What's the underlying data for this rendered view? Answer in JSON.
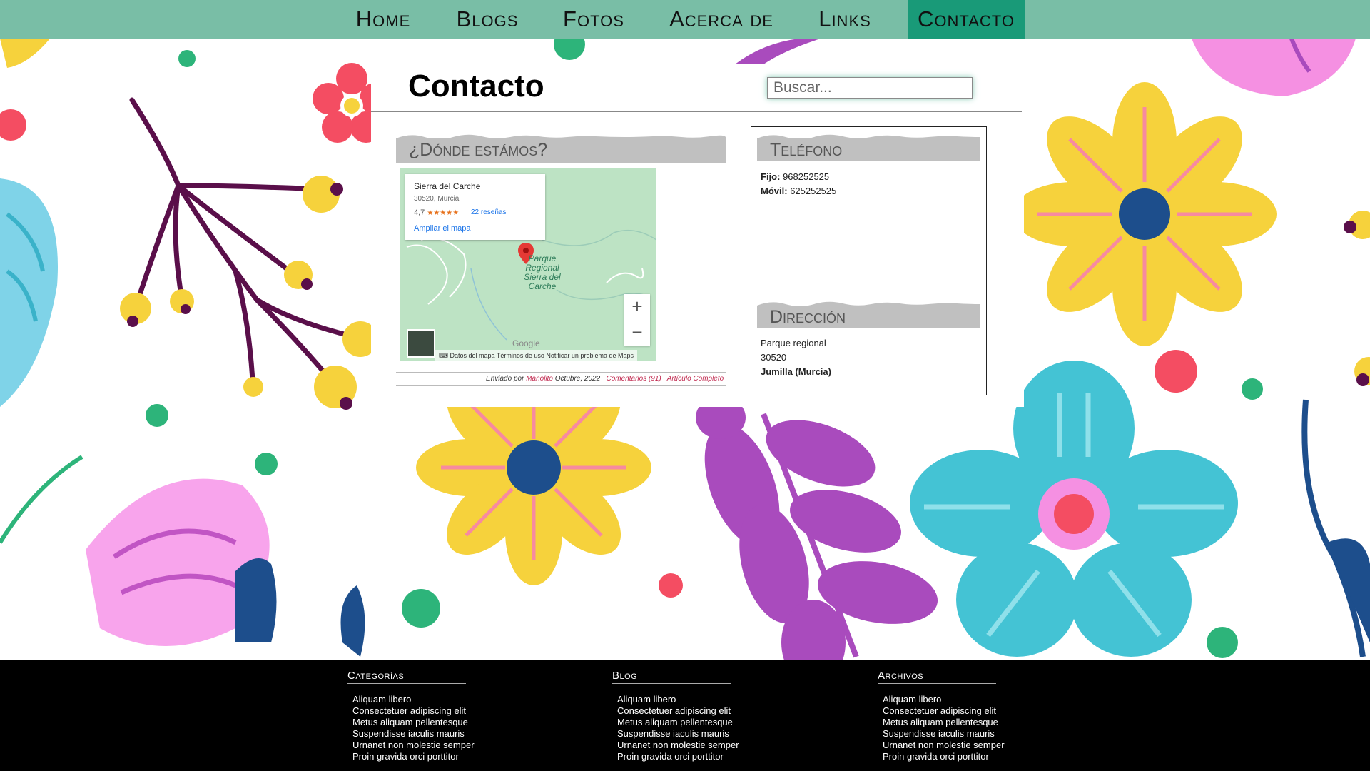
{
  "nav": {
    "items": [
      "Home",
      "Blogs",
      "Fotos",
      "Acerca de",
      "Links",
      "Contacto"
    ],
    "active": "Contacto"
  },
  "page": {
    "title": "Contacto",
    "search_placeholder": "Buscar..."
  },
  "where": {
    "heading": "¿Dónde estámos?",
    "map": {
      "place_name": "Sierra del Carche",
      "place_address": "30520, Murcia",
      "rating": "4,7",
      "stars": "★★★★★",
      "reviews": "22 reseñas",
      "enlarge": "Ampliar el mapa",
      "pin_label": "Parque Regional Sierra del Carche",
      "zoom_in": "+",
      "zoom_out": "−",
      "google": "Google",
      "footer_links": "Datos del mapa   Términos de uso   Notificar un problema de Maps"
    },
    "posted": {
      "by_prefix": "Enviado por",
      "author": "Manolito",
      "date": "Octubre, 2022",
      "comments": "Comentarios (91)",
      "full": "Artículo Completo"
    }
  },
  "phone": {
    "heading": "Teléfono",
    "fixed_label": "Fijo:",
    "fixed": "968252525",
    "mobile_label": "Móvil:",
    "mobile": "625252525"
  },
  "address": {
    "heading": "Dirección",
    "line1": "Parque regional",
    "line2": "30520",
    "line3": "Jumilla (Murcia)"
  },
  "footer": {
    "columns": [
      {
        "title": "Categorías",
        "items": [
          "Aliquam libero",
          "Consectetuer adipiscing elit",
          "Metus aliquam pellentesque",
          "Suspendisse iaculis mauris",
          "Urnanet non molestie semper",
          "Proin gravida orci porttitor"
        ]
      },
      {
        "title": "Blog",
        "items": [
          "Aliquam libero",
          "Consectetuer adipiscing elit",
          "Metus aliquam pellentesque",
          "Suspendisse iaculis mauris",
          "Urnanet non molestie semper",
          "Proin gravida orci porttitor"
        ]
      },
      {
        "title": "Archivos",
        "items": [
          "Aliquam libero",
          "Consectetuer adipiscing elit",
          "Metus aliquam pellentesque",
          "Suspendisse iaculis mauris",
          "Urnanet non molestie semper",
          "Proin gravida orci porttitor"
        ]
      }
    ]
  },
  "colors": {
    "nav_bg": "#79bea6",
    "nav_active": "#199a78",
    "section_head": "#c0c0c0",
    "link": "#c0284e",
    "footer_bg": "#000000"
  }
}
